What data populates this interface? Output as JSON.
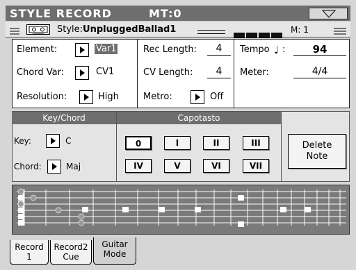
{
  "header": {
    "title": "STYLE RECORD",
    "mt": "MT:0"
  },
  "info": {
    "style_prefix": "Style:",
    "style_name": "UnpluggedBallad1",
    "measure": "M:  1"
  },
  "params": {
    "element_label": "Element:",
    "element_value": "Var1",
    "chordvar_label": "Chord Var:",
    "chordvar_value": "CV1",
    "resolution_label": "Resolution:",
    "resolution_value": "High",
    "rec_length_label": "Rec Length:",
    "rec_length_value": "4",
    "cv_length_label": "CV Length:",
    "cv_length_value": "4",
    "metro_label": "Metro:",
    "metro_value": "Off",
    "tempo_label": "Tempo",
    "tempo_value": "94",
    "meter_label": "Meter:",
    "meter_value": "4/4"
  },
  "keychord": {
    "header": "Key/Chord",
    "key_label": "Key:",
    "key_value": "C",
    "chord_label": "Chord:",
    "chord_value": "Maj"
  },
  "capotasto": {
    "header": "Capotasto",
    "buttons": [
      "0",
      "I",
      "II",
      "III",
      "IV",
      "V",
      "VI",
      "VII"
    ],
    "selected": "0"
  },
  "delete_note": {
    "line1": "Delete",
    "line2": "Note"
  },
  "tabs": [
    {
      "line1": "Record",
      "line2": "1"
    },
    {
      "line1": "Record2",
      "line2": "Cue"
    },
    {
      "line1": "Guitar",
      "line2": "Mode"
    }
  ],
  "active_tab": "Guitar Mode"
}
